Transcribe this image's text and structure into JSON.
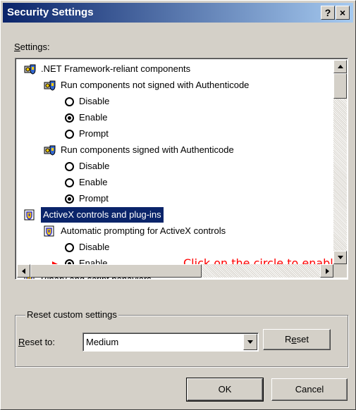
{
  "window": {
    "title": "Security Settings",
    "help_label": "?",
    "close_label": "×"
  },
  "settings": {
    "label": "Settings:",
    "items": [
      {
        "kind": "group",
        "icon": "gear-shield-icon",
        "label": ".NET Framework-reliant components"
      },
      {
        "kind": "group",
        "icon": "gear-shield-icon",
        "label": "Run components not signed with Authenticode"
      },
      {
        "kind": "option",
        "label": "Disable",
        "checked": false
      },
      {
        "kind": "option",
        "label": "Enable",
        "checked": true
      },
      {
        "kind": "option",
        "label": "Prompt",
        "checked": false
      },
      {
        "kind": "group",
        "icon": "gear-shield-icon",
        "label": "Run components signed with Authenticode"
      },
      {
        "kind": "option",
        "label": "Disable",
        "checked": false
      },
      {
        "kind": "option",
        "label": "Enable",
        "checked": false
      },
      {
        "kind": "option",
        "label": "Prompt",
        "checked": true
      },
      {
        "kind": "group",
        "icon": "activex-shield-icon",
        "label": "ActiveX controls and plug-ins",
        "selected": true
      },
      {
        "kind": "group",
        "icon": "activex-shield-icon",
        "label": "Automatic prompting for ActiveX controls"
      },
      {
        "kind": "option",
        "label": "Disable",
        "checked": false
      },
      {
        "kind": "option",
        "label": "Enable",
        "checked": true
      },
      {
        "kind": "group",
        "icon": "activex-shield-icon",
        "label": "Binary and script behaviors"
      }
    ],
    "annotation": "Click on the circle to enable"
  },
  "reset": {
    "group_label": "Reset custom settings",
    "reset_to_label": "Reset to:",
    "level_value": "Medium",
    "reset_button": "Reset"
  },
  "footer": {
    "ok_label": "OK",
    "cancel_label": "Cancel"
  },
  "colors": {
    "title_start": "#0a246a",
    "title_end": "#a6caf0",
    "annotation": "#ff0000",
    "arrow": "#ff0000",
    "selection": "#0a246a"
  }
}
